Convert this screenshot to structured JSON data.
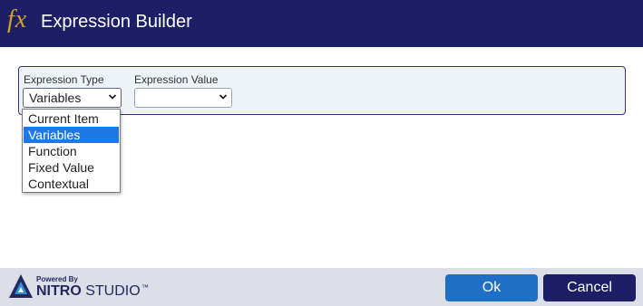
{
  "window": {
    "icon": "fx-icon",
    "icon_text": "fx",
    "title": "Expression Builder"
  },
  "form": {
    "expression_type": {
      "label": "Expression Type",
      "selected": "Variables",
      "options": [
        "Current Item",
        "Variables",
        "Function",
        "Fixed Value",
        "Contextual"
      ],
      "open": true
    },
    "expression_value": {
      "label": "Expression Value",
      "selected": ""
    }
  },
  "footer": {
    "powered_by": "Powered By",
    "brand_bold": "NITRO",
    "brand_rest": " STUDIO",
    "trademark": "™",
    "ok_label": "Ok",
    "cancel_label": "Cancel"
  },
  "colors": {
    "titlebar": "#1c1f66",
    "accent_gold": "#d4a12a",
    "selected_option": "#1e78e6",
    "ok_button": "#1f6fc7",
    "cancel_button": "#1c1f66",
    "panel_border": "#30367a"
  }
}
